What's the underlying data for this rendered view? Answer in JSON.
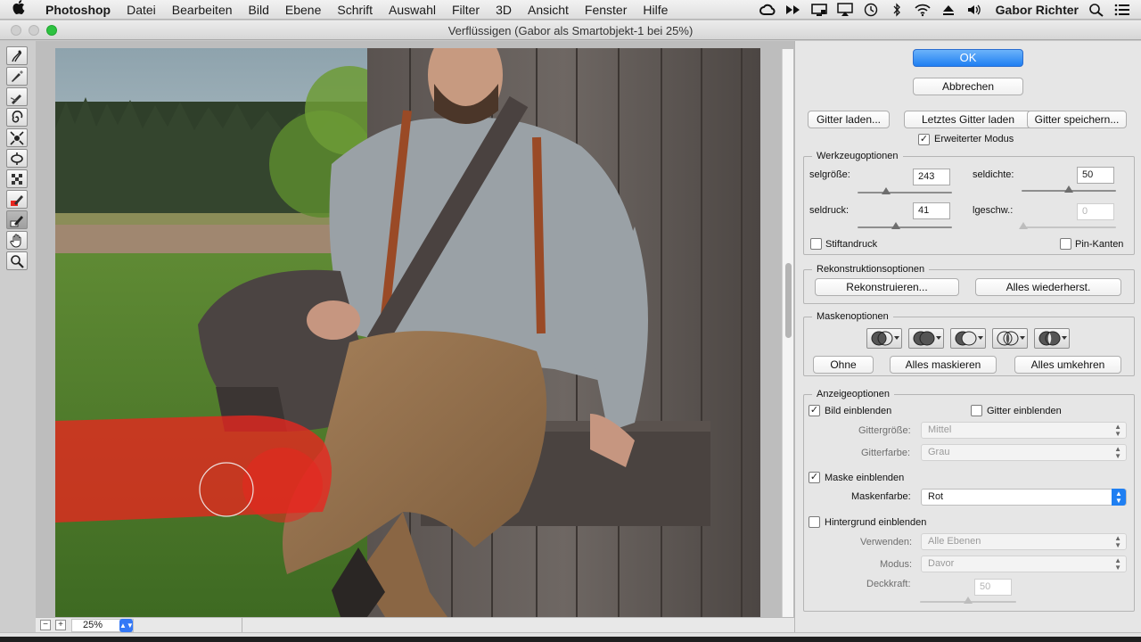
{
  "menubar": {
    "items": [
      "Photoshop",
      "Datei",
      "Bearbeiten",
      "Bild",
      "Ebene",
      "Schrift",
      "Auswahl",
      "Filter",
      "3D",
      "Ansicht",
      "Fenster",
      "Hilfe"
    ],
    "user": "Gabor Richter"
  },
  "window": {
    "title": "Verflüssigen (Gabor als Smartobjekt-1 bei 25%)"
  },
  "canvas": {
    "zoom_value": "25%"
  },
  "panel": {
    "ok_label": "OK",
    "cancel_label": "Abbrechen",
    "mesh": {
      "load_label": "Gitter laden...",
      "load_last_label": "Letztes Gitter laden",
      "save_label": "Gitter speichern..."
    },
    "advanced_mode": {
      "label": "Erweiterter Modus",
      "checked": true
    },
    "tool_options": {
      "legend": "Werkzeugoptionen",
      "brush_size": {
        "label": "selgröße:",
        "value": "243",
        "level": 0.3
      },
      "brush_density": {
        "label": "seldichte:",
        "value": "50",
        "level": 0.5
      },
      "brush_pressure": {
        "label": "seldruck:",
        "value": "41",
        "level": 0.41
      },
      "brush_rate": {
        "label": "lgeschw.:",
        "value": "0",
        "level": 0.0
      },
      "stylus_label": "Stiftandruck",
      "stylus_checked": false,
      "pin_edges_label": "Pin-Kanten",
      "pin_edges_checked": false
    },
    "reconstruct": {
      "legend": "Rekonstruktionsoptionen",
      "reconstruct_label": "Rekonstruieren...",
      "restore_all_label": "Alles wiederherst."
    },
    "mask": {
      "legend": "Maskenoptionen",
      "none_label": "Ohne",
      "mask_all_label": "Alles maskieren",
      "invert_all_label": "Alles umkehren"
    },
    "view": {
      "legend": "Anzeigeoptionen",
      "show_image_label": "Bild einblenden",
      "show_image_checked": true,
      "show_mesh_label": "Gitter einblenden",
      "show_mesh_checked": false,
      "mesh_size_label": "Gittergröße:",
      "mesh_size_value": "Mittel",
      "mesh_color_label": "Gitterfarbe:",
      "mesh_color_value": "Grau",
      "show_mask_label": "Maske einblenden",
      "show_mask_checked": true,
      "mask_color_label": "Maskenfarbe:",
      "mask_color_value": "Rot",
      "show_backdrop_label": "Hintergrund einblenden",
      "show_backdrop_checked": false,
      "use_label": "Verwenden:",
      "use_value": "Alle Ebenen",
      "mode_label": "Modus:",
      "mode_value": "Davor",
      "opacity_label": "Deckkraft:",
      "opacity_value": "50",
      "opacity_level": 0.5
    }
  },
  "colors": {
    "accent": "#1f7ff2",
    "mask_red": "#e8261f"
  }
}
